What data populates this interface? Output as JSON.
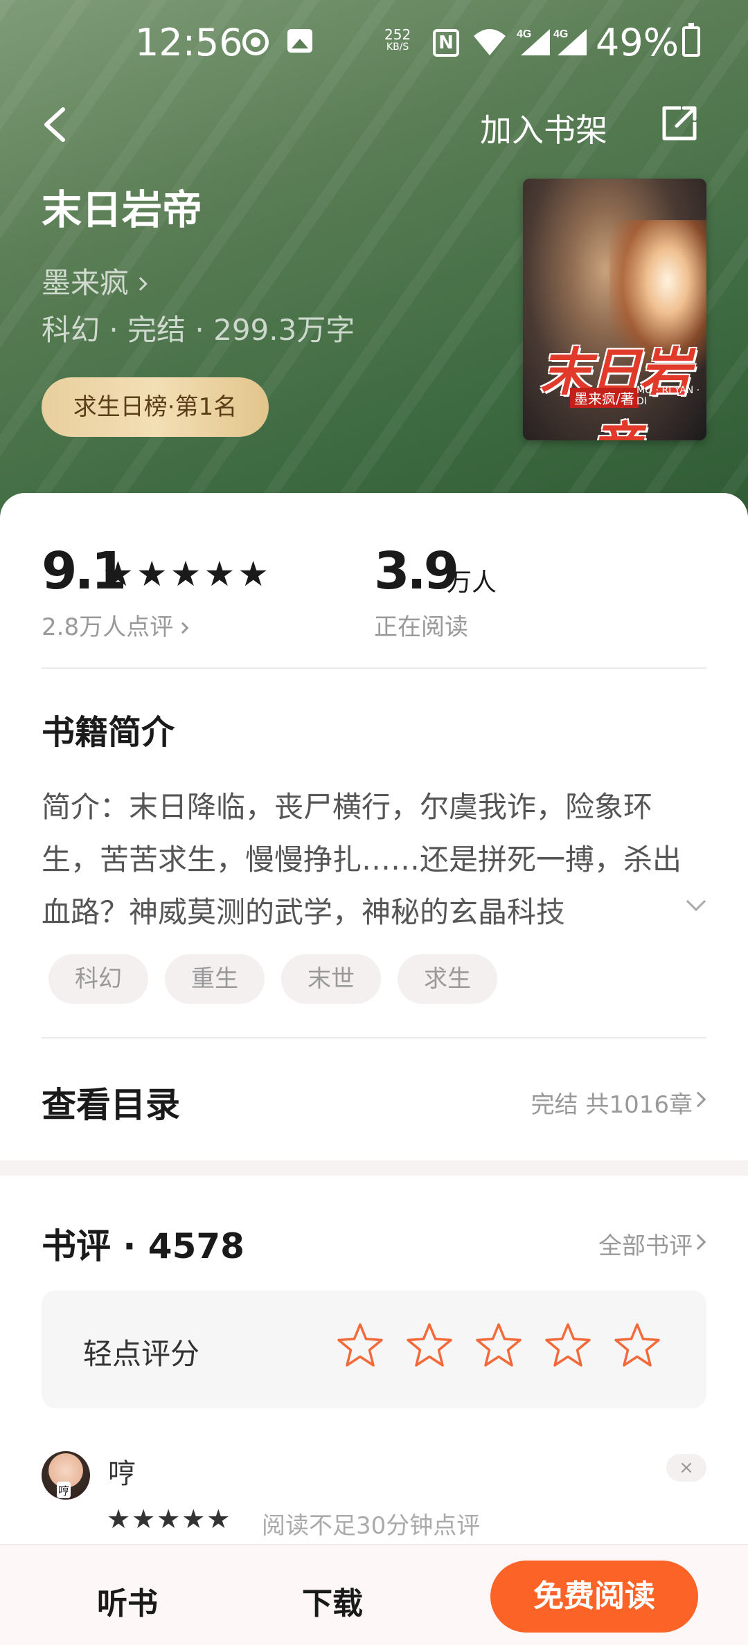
{
  "status_bar": {
    "time": "12:56",
    "net_speed_value": "252",
    "net_speed_unit": "KB/S",
    "nfc": "N",
    "network_1": "4G",
    "network_2": "4G",
    "battery": "49%"
  },
  "nav": {
    "add_to_shelf": "加入书架"
  },
  "book": {
    "title": "末日岩帝",
    "author": "墨来疯",
    "meta": "科幻 · 完结 · 299.3万字",
    "rank_badge": "求生日榜·第1名",
    "cover": {
      "title": "末日岩帝",
      "author": "墨来疯/著",
      "pinyin": "MO · RI YAN · DI"
    }
  },
  "stats": {
    "score": "9.1",
    "score_stars": "★★★★★",
    "rating_count": "2.8万人点评",
    "readers": "3.9",
    "readers_unit": "万人",
    "readers_label": "正在阅读"
  },
  "intro": {
    "heading": "书籍简介",
    "text": "简介：末日降临，丧尸横行，尔虞我诈，险象环生，苦苦求生，慢慢挣扎……还是拼死一搏，杀出血路？神威莫测的武学，神秘的玄晶科技"
  },
  "tags": [
    "科幻",
    "重生",
    "末世",
    "求生"
  ],
  "toc": {
    "label": "查看目录",
    "meta": "完结 共1016章"
  },
  "reviews": {
    "title": "书评 · 4578",
    "all_label": "全部书评",
    "rate_prompt": "轻点评分",
    "rate_star_count": 5,
    "accent_color": "#f26a3a",
    "items": [
      {
        "name": "哼",
        "avatar_text": "哼",
        "stars": "★★★★★",
        "note": "阅读不足30分钟点评",
        "dismiss": "×"
      }
    ]
  },
  "bottom_bar": {
    "listen": "听书",
    "download": "下载",
    "read_free": "免费阅读",
    "read_color": "#fb6327"
  }
}
